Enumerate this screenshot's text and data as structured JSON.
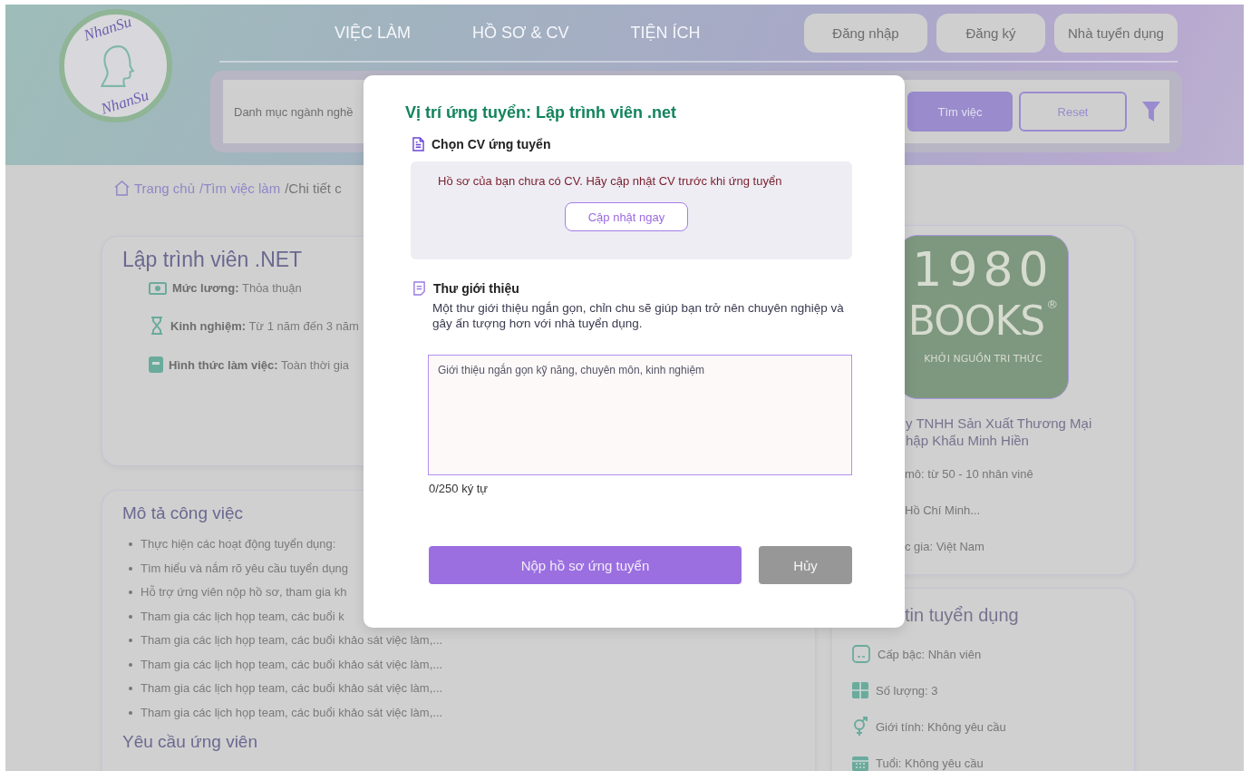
{
  "header": {
    "logo": {
      "top_text": "NhanSu",
      "bottom_text": "NhanSu"
    },
    "nav": [
      {
        "label": "VIỆC LÀM"
      },
      {
        "label": "HỒ SƠ & CV"
      },
      {
        "label": "TIỆN ÍCH"
      }
    ],
    "auth_buttons": [
      {
        "label": "Đăng nhập"
      },
      {
        "label": "Đăng ký"
      },
      {
        "label": "Nhà tuyển dụng"
      }
    ],
    "search": {
      "placeholder": "Danh mục ngành nghề",
      "search_button": "Tìm việc",
      "reset_button": "Reset"
    }
  },
  "breadcrumb": [
    {
      "label": "Trang chủ",
      "kind": "home"
    },
    {
      "label": "/Tìm việc làm",
      "kind": "link"
    },
    {
      "label": "/Chi tiết c",
      "kind": "current"
    }
  ],
  "job": {
    "title": "Lập trình viên .NET",
    "facts": [
      {
        "kind": "money",
        "text": "**Mức lương:** Thỏa thuận"
      },
      {
        "kind": "hourglass",
        "text": "**Kinh nghiệm:** Từ 1 năm đến 3 năm"
      },
      {
        "kind": "card",
        "text": "**Hình thức làm việc:** Toàn thời gia"
      }
    ]
  },
  "description": {
    "title": "Mô tả công việc",
    "items": [
      "Thực hiện các hoạt động tuyển dụng:",
      "Tìm hiểu và nắm rõ yêu cầu tuyển dụng",
      "Hỗ trợ ứng viên nộp hồ sơ, tham gia kh",
      "Tham gia các lịch họp team, các buổi k",
      "Tham gia các lịch họp team, các buổi khảo sát việc làm,...",
      "Tham gia các lịch họp team, các buổi khảo sát việc làm,...",
      "Tham gia các lịch họp team, các buổi khảo sát việc làm,...",
      "Tham gia các lịch họp team, các buổi khảo sát việc làm,..."
    ]
  },
  "requirements": {
    "title": "Yêu cầu ứng viên"
  },
  "company": {
    "logo": {
      "number": "1980",
      "word": "BOOKS",
      "mark": "®",
      "slogan": "KHỞI NGUỒN TRI THỨC"
    },
    "name_lines": [
      "y TNHH Sản Xuất Thương Mại",
      "hập Khẩu Minh Hiền"
    ],
    "facts": [
      "mô: từ 50 - 10 nhân vinê",
      "Hồ Chí Minh...",
      "c gia: Việt Nam"
    ]
  },
  "recruitment_info": {
    "title": "tin tuyển dụng",
    "items": [
      {
        "kind": "level",
        "text": "Cấp bậc: Nhân viên"
      },
      {
        "kind": "grid",
        "text": "Số lượng: 3"
      },
      {
        "kind": "gender",
        "text": "Giới tính: Không yêu cầu"
      },
      {
        "kind": "calendar",
        "text": "Tuổi: Không yêu cầu"
      }
    ]
  },
  "modal": {
    "title": "Vị trí ứng tuyển: Lập trình viên .net",
    "cv_section": {
      "title": "Chọn CV ứng tuyển",
      "message": "Hồ sơ của bạn chưa có CV. Hãy cập nhật CV trước khi ứng tuyển",
      "update_button": "Cập nhật ngay"
    },
    "letter_section": {
      "title": "Thư giới thiệu",
      "description": "Một thư giới thiệu ngắn gọn, chỉn chu sẽ giúp bạn trở nên chuyên nghiệp và gây ấn tượng hơn với nhà tuyển dụng.",
      "placeholder": "Giới thiệu ngắn gọn kỹ năng, chuyên môn, kinh nghiệm",
      "counter": "0/250 ký tự"
    },
    "submit_button": "Nộp hồ sơ ứng tuyển",
    "cancel_button": "Hủy"
  }
}
